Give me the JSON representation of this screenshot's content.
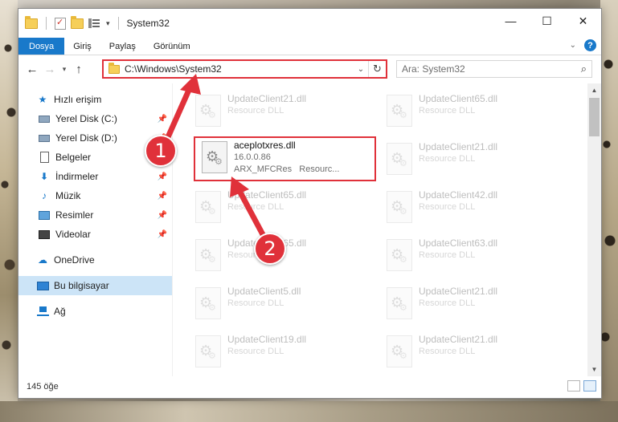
{
  "window": {
    "title": "System32",
    "controls": {
      "minimize": "—",
      "maximize": "☐",
      "close": "✕"
    }
  },
  "ribbon": {
    "tabs": [
      "Dosya",
      "Giriş",
      "Paylaş",
      "Görünüm"
    ]
  },
  "address": {
    "path": "C:\\Windows\\System32",
    "search_placeholder": "Ara: System32"
  },
  "nav_pane": {
    "items": [
      {
        "label": "Hızlı erişim",
        "icon": "star-icon",
        "pinned": false
      },
      {
        "label": "Yerel Disk (C:)",
        "icon": "drive-icon",
        "pinned": true
      },
      {
        "label": "Yerel Disk (D:)",
        "icon": "drive-icon",
        "pinned": true
      },
      {
        "label": "Belgeler",
        "icon": "documents-icon",
        "pinned": true
      },
      {
        "label": "İndirmeler",
        "icon": "downloads-icon",
        "pinned": true
      },
      {
        "label": "Müzik",
        "icon": "music-icon",
        "pinned": true
      },
      {
        "label": "Resimler",
        "icon": "pictures-icon",
        "pinned": true
      },
      {
        "label": "Videolar",
        "icon": "videos-icon",
        "pinned": true
      },
      {
        "label": "OneDrive",
        "icon": "onedrive-icon",
        "pinned": false
      },
      {
        "label": "Bu bilgisayar",
        "icon": "this-pc-icon",
        "pinned": false,
        "selected": true
      },
      {
        "label": "Ağ",
        "icon": "network-icon",
        "pinned": false
      }
    ]
  },
  "files": {
    "highlighted": {
      "name": "aceplotxres.dll",
      "version": "16.0.0.86",
      "company": "ARX_MFCRes",
      "description": "Resourc..."
    },
    "faded": [
      {
        "name": "UpdateClient21.dll",
        "type": "Resource DLL"
      },
      {
        "name": "UpdateClient65.dll",
        "type": "Resource DLL"
      },
      {
        "name": "UpdateClient21.dll",
        "type": "Resource DLL"
      },
      {
        "name": "UpdateClient65.dll",
        "type": "Resource DLL"
      },
      {
        "name": "UpdateClient42.dll",
        "type": "Resource DLL"
      },
      {
        "name": "UpdateClient65.dll",
        "type": "Resource DLL"
      },
      {
        "name": "UpdateClient63.dll",
        "type": "Resource DLL"
      },
      {
        "name": "UpdateClient5.dll",
        "type": "Resource DLL"
      },
      {
        "name": "UpdateClient21.dll",
        "type": "Resource DLL"
      },
      {
        "name": "UpdateClient19.dll",
        "type": "Resource DLL"
      },
      {
        "name": "UpdateClient21.dll",
        "type": "Resource DLL"
      }
    ]
  },
  "status": {
    "item_count": "145 öğe"
  },
  "callouts": {
    "first": "1",
    "second": "2"
  },
  "colors": {
    "accent": "#1979ca",
    "highlight": "#e0313a"
  }
}
